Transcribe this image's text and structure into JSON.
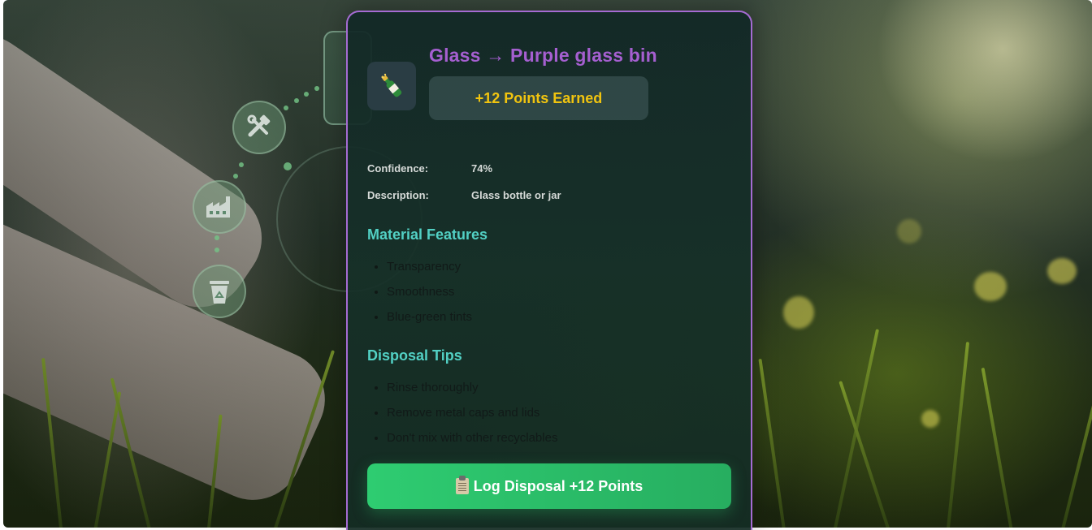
{
  "background": {
    "eco_icons": [
      "tools-icon",
      "factory-icon",
      "recycle-bin-icon"
    ]
  },
  "result": {
    "item_icon": "champagne-bottle-icon",
    "title": "Glass → Purple glass bin",
    "points_earned": "+12 Points Earned",
    "confidence_label": "Confidence:",
    "confidence_value": "74%",
    "description_label": "Description:",
    "description_value": "Glass bottle or jar"
  },
  "material_features": {
    "heading": "Material Features",
    "items": [
      "Transparency",
      "Smoothness",
      "Blue-green tints"
    ]
  },
  "disposal_tips": {
    "heading": "Disposal Tips",
    "items": [
      "Rinse thoroughly",
      "Remove metal caps and lids",
      "Don't mix with other recyclables"
    ]
  },
  "action": {
    "icon": "clipboard-icon",
    "label": "Log Disposal +12 Points"
  },
  "colors": {
    "title": "#a55fd0",
    "points": "#f1c40f",
    "section_heading": "#52d0c4",
    "button": "#2ecc71",
    "card_border": "#a56bd3"
  }
}
